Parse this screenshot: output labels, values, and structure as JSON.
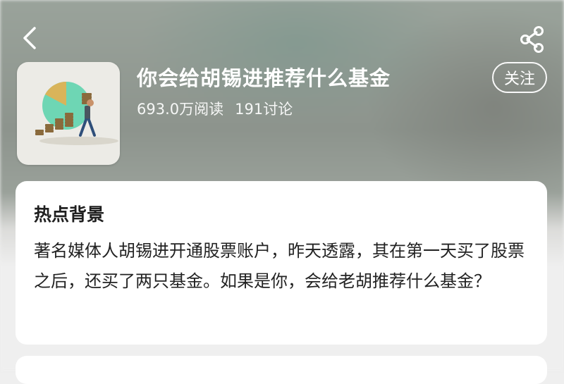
{
  "nav": {
    "back_icon": "chevron-left-icon",
    "share_icon": "share-icon"
  },
  "topic": {
    "title": "你会给胡锡进推荐什么基金",
    "reads": "693.0万阅读",
    "discussions": "191讨论",
    "follow_label": "关注",
    "cover_icon": "investment-illustration"
  },
  "background_card": {
    "title": "热点背景",
    "body": "著名媒体人胡锡进开通股票账户，昨天透露，其在第一天买了股票之后，还买了两只基金。如果是你，会给老胡推荐什么基金？"
  },
  "colors": {
    "accent_white": "#ffffff",
    "card_bg": "#ffffff",
    "page_bg": "#efefef",
    "pie_teal": "#6ed6b4",
    "pie_gold": "#d9b45a",
    "coin_brown": "#8a6a3c"
  }
}
